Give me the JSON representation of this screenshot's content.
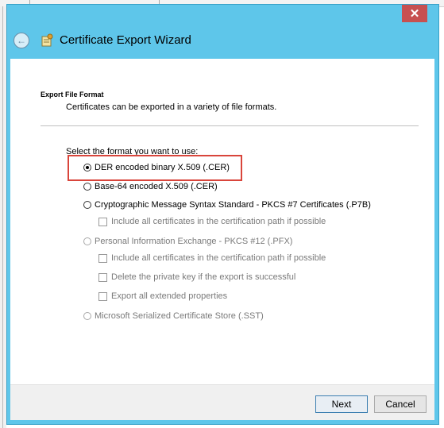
{
  "window": {
    "title": "Certificate Export Wizard",
    "close_label": "✕"
  },
  "header": {
    "back_label": "←"
  },
  "section": {
    "title": "Export File Format",
    "subtitle": "Certificates can be exported in a variety of file formats."
  },
  "prompt": "Select the format you want to use:",
  "options": {
    "der": "DER encoded binary X.509 (.CER)",
    "base64": "Base-64 encoded X.509 (.CER)",
    "pkcs7": "Cryptographic Message Syntax Standard - PKCS #7 Certificates (.P7B)",
    "pkcs7_include": "Include all certificates in the certification path if possible",
    "pfx": "Personal Information Exchange - PKCS #12 (.PFX)",
    "pfx_include": "Include all certificates in the certification path if possible",
    "pfx_delete": "Delete the private key if the export is successful",
    "pfx_export_props": "Export all extended properties",
    "sst": "Microsoft Serialized Certificate Store (.SST)"
  },
  "selected_option": "der",
  "buttons": {
    "next": "Next",
    "cancel": "Cancel"
  },
  "colors": {
    "titlebar": "#5ec6ea",
    "highlight": "#d9453b",
    "close": "#c75050"
  }
}
